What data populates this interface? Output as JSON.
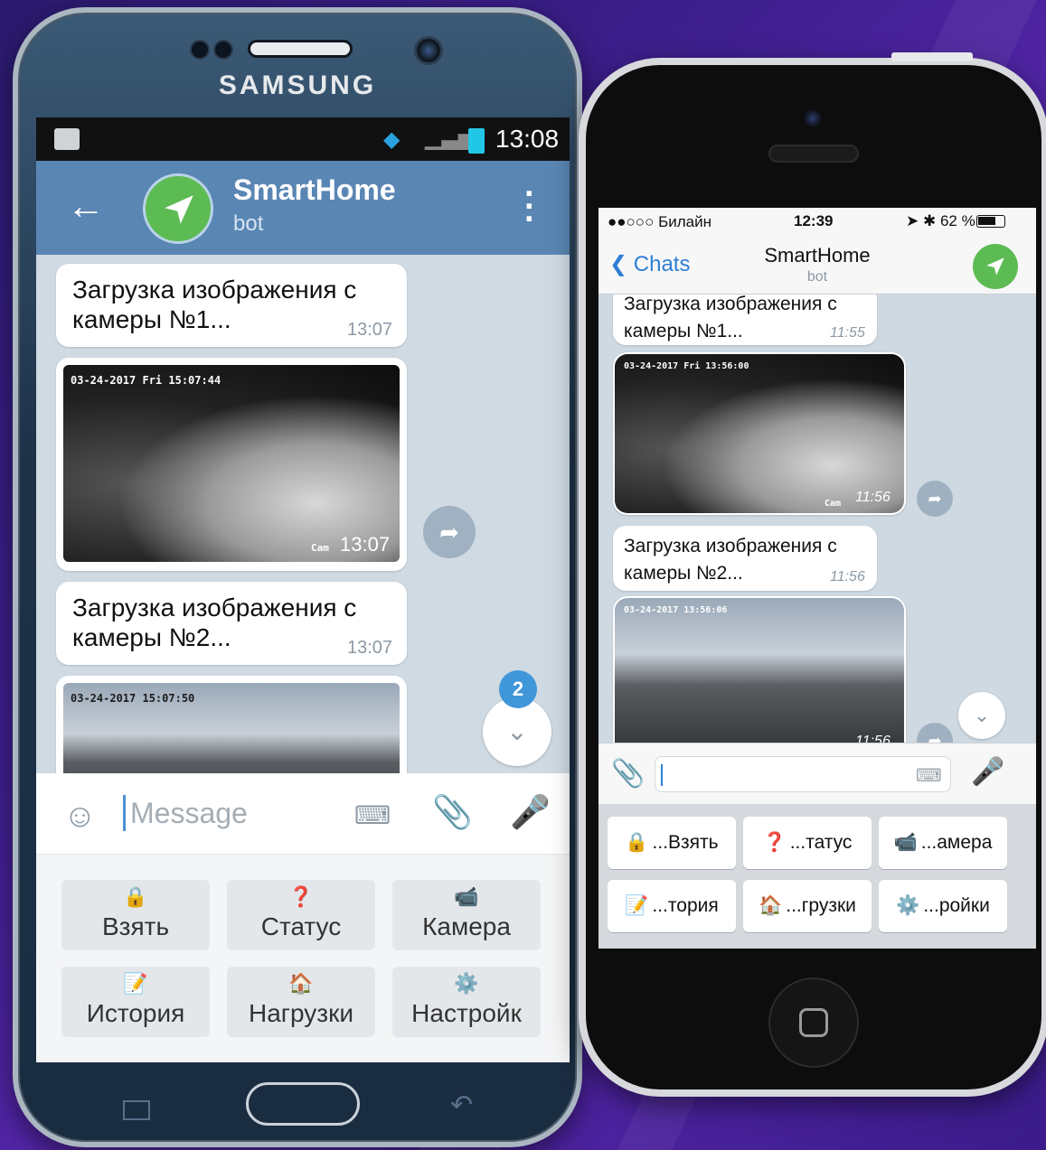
{
  "samsung": {
    "brand": "SAMSUNG",
    "status": {
      "time": "13:08"
    },
    "header": {
      "back_icon": "arrow-left-icon",
      "title": "SmartHome",
      "subtitle": "bot",
      "menu_icon": "more-vertical-icon"
    },
    "messages": [
      {
        "type": "text",
        "text": "Загрузка изображения с камеры №1...",
        "time": "13:07"
      },
      {
        "type": "photo",
        "stamp": "03-24-2017 Fri 15:07:44",
        "cam_label": "Cam",
        "time": "13:07"
      },
      {
        "type": "text",
        "text": "Загрузка изображения с камеры №2...",
        "time": "13:07"
      },
      {
        "type": "photo",
        "stamp": "03-24-2017 15:07:50"
      }
    ],
    "unread_badge": "2",
    "input": {
      "placeholder": "Message"
    },
    "keyboard": [
      {
        "icon": "🔒",
        "label": "Взять"
      },
      {
        "icon": "❓",
        "label": "Статус"
      },
      {
        "icon": "📹",
        "label": "Камера"
      },
      {
        "icon": "📝",
        "label": "История"
      },
      {
        "icon": "🏠",
        "label": "Нагрузки"
      },
      {
        "icon": "⚙️",
        "label": "Настройк"
      }
    ]
  },
  "iphone": {
    "status": {
      "carrier": "●●○○○ Билайн",
      "time": "12:39",
      "battery": "62 %"
    },
    "nav": {
      "back_label": "Chats",
      "title": "SmartHome",
      "subtitle": "bot"
    },
    "messages": [
      {
        "type": "text",
        "text": "Загрузка изображения с камеры №1...",
        "time": "11:55"
      },
      {
        "type": "photo",
        "stamp": "03-24-2017 Fri 13:56:00",
        "cam_label": "Cam",
        "time": "11:56"
      },
      {
        "type": "text",
        "text": "Загрузка изображения с камеры №2...",
        "time": "11:56"
      },
      {
        "type": "photo",
        "stamp": "03-24-2017 13:56:06",
        "time": "11:56"
      }
    ],
    "keyboard": [
      {
        "icon": "🔒",
        "label": "...Взять"
      },
      {
        "icon": "❓",
        "label": "...татус"
      },
      {
        "icon": "📹",
        "label": "...амера"
      },
      {
        "icon": "📝",
        "label": "...тория"
      },
      {
        "icon": "🏠",
        "label": "...грузки"
      },
      {
        "icon": "⚙️",
        "label": "...ройки"
      }
    ]
  },
  "colors": {
    "telegram_header": "#5a86b4",
    "bot_avatar": "#5dbb53",
    "ios_accent": "#2f7fd6",
    "badge": "#3f96d8"
  }
}
